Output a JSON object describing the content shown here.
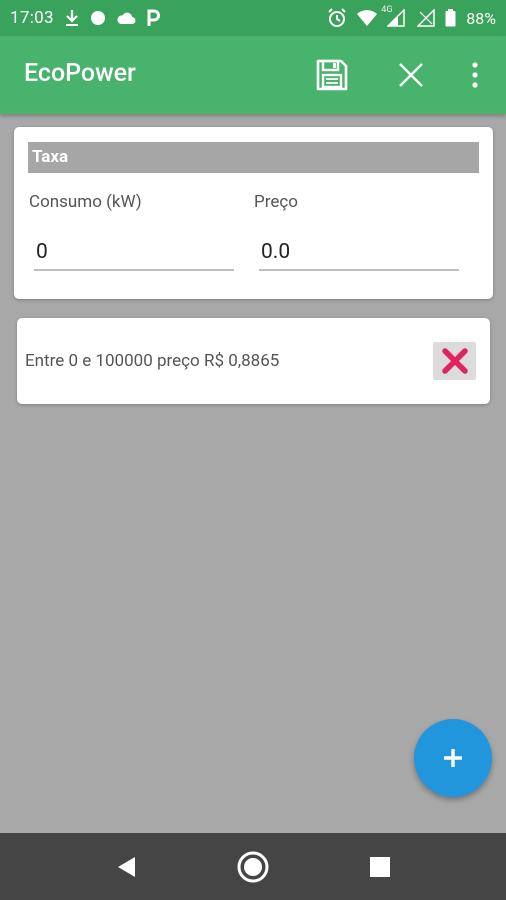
{
  "status_bar": {
    "time": "17:03",
    "battery": "88%",
    "network": "4G",
    "icons_left": [
      "download-icon",
      "circle-icon",
      "cloud-icon",
      "parking-icon"
    ],
    "icons_right": [
      "alarm-icon",
      "wifi-icon",
      "signal-icon",
      "signal-empty-icon",
      "battery-icon"
    ]
  },
  "app_bar": {
    "title": "EcoPower",
    "actions": [
      "save-icon",
      "close-icon",
      "more-vert-icon"
    ]
  },
  "tax_card": {
    "header": "Taxa",
    "consumption_label": "Consumo (kW)",
    "consumption_value": "0",
    "price_label": "Preço",
    "price_value": "0.0"
  },
  "range_item": {
    "text": "Entre 0 e 100000 preço R$ 0,8865",
    "delete_icon": "red-x-icon"
  },
  "fab": {
    "icon": "plus-icon"
  },
  "nav_bar": {
    "buttons": [
      "back-icon",
      "home-icon",
      "recents-icon"
    ]
  },
  "colors": {
    "status_bar": "#3aa35b",
    "app_bar": "#48b36d",
    "background": "#a8a8a8",
    "fab": "#2296dc",
    "delete_x": "#e0245e",
    "nav_bar": "#454545"
  }
}
